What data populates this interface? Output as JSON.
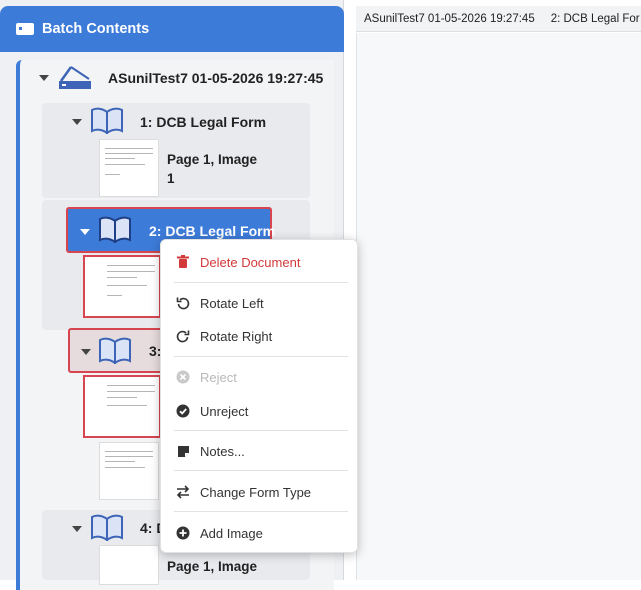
{
  "panel": {
    "title": "Batch Contents"
  },
  "batch": {
    "name": "ASunilTest7 01-05-2026 19:27:45"
  },
  "documents": [
    {
      "label": "1: DCB Legal Form",
      "page_label": "Page 1, Image 1"
    },
    {
      "label": "2: DCB Legal Form"
    },
    {
      "label": "3:"
    },
    {
      "label": "4: D",
      "page_label": "Page 1, Image"
    }
  ],
  "tabs": [
    "ASunilTest7 01-05-2026 19:27:45",
    "2: DCB Legal For"
  ],
  "context_menu": {
    "delete": "Delete Document",
    "rotate_left": "Rotate Left",
    "rotate_right": "Rotate Right",
    "reject": "Reject",
    "unreject": "Unreject",
    "notes": "Notes...",
    "change_form_type": "Change Form Type",
    "add_image": "Add Image"
  },
  "colors": {
    "accent": "#3d7bd9",
    "danger": "#d23a3a",
    "reject_border": "#d64550"
  }
}
